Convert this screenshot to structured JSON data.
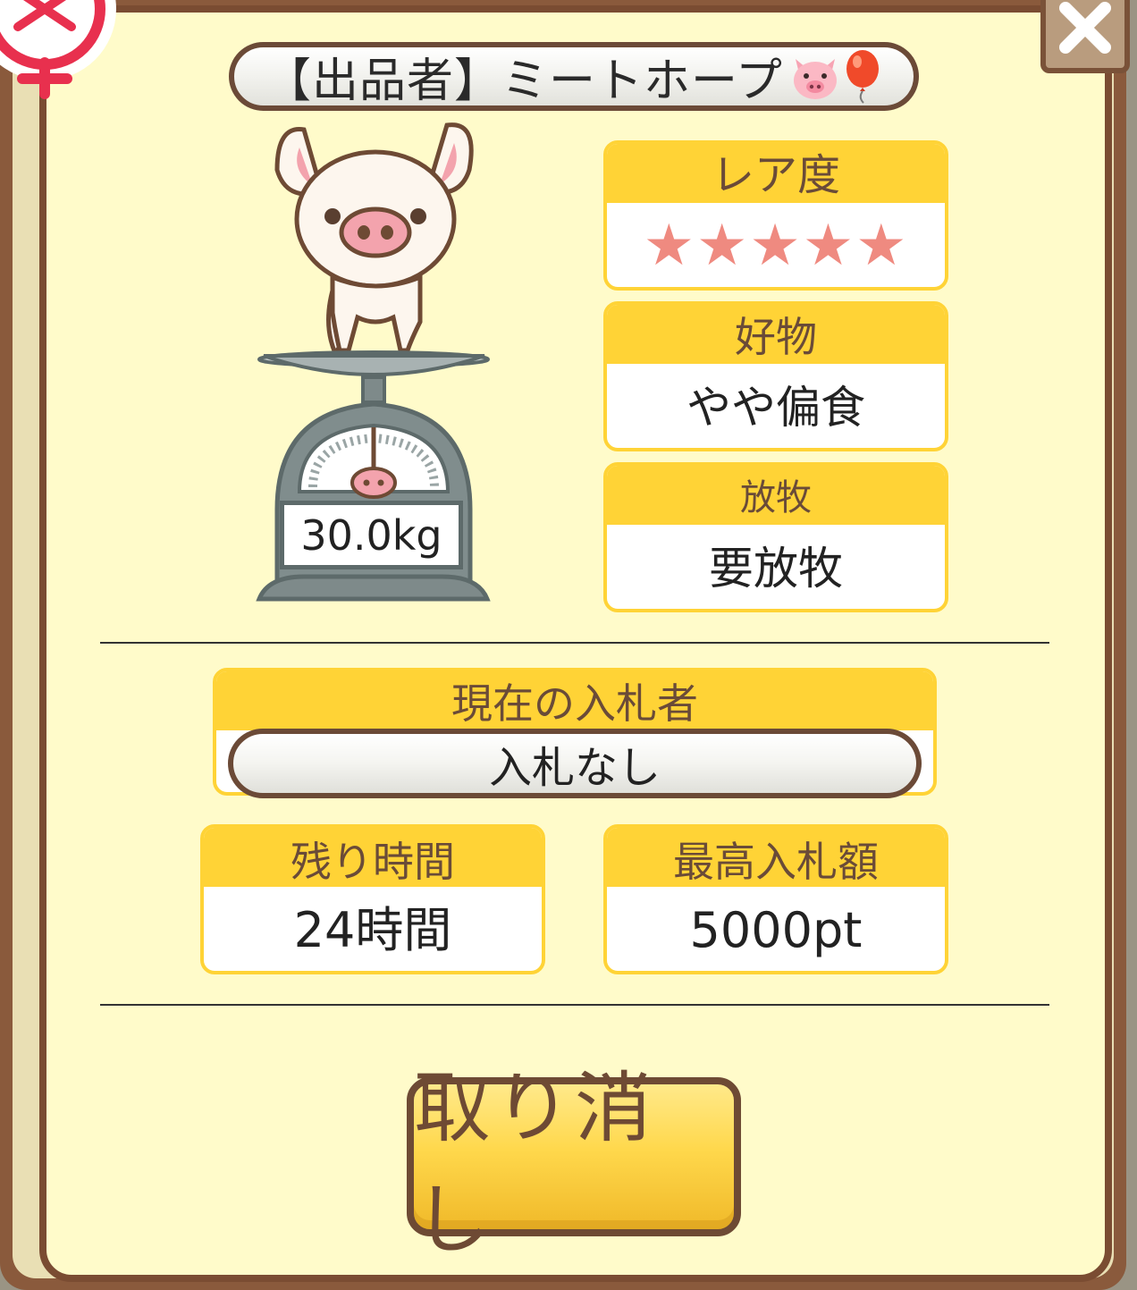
{
  "seller": {
    "label": "【出品者】ミートホープ",
    "icons": [
      "pig-face-icon",
      "balloon-icon"
    ]
  },
  "pig": {
    "weight": "30.0kg"
  },
  "rarity": {
    "title": "レア度",
    "stars": "★★★★★",
    "rating": 5,
    "max": 5
  },
  "favorite": {
    "title": "好物",
    "value": "やや偏食"
  },
  "grazing": {
    "title": "放牧",
    "value": "要放牧"
  },
  "bidder": {
    "title": "現在の入札者",
    "value": "入札なし"
  },
  "remaining": {
    "title": "残り時間",
    "value": "24時間"
  },
  "highest": {
    "title": "最高入札額",
    "value": "5000pt"
  },
  "cancel": {
    "label": "取り消し"
  },
  "colors": {
    "frame": "#7a4c32",
    "panel": "#fffbca",
    "card_header": "#ffd336",
    "star": "#ef8a80",
    "button": "#ffd84c"
  }
}
